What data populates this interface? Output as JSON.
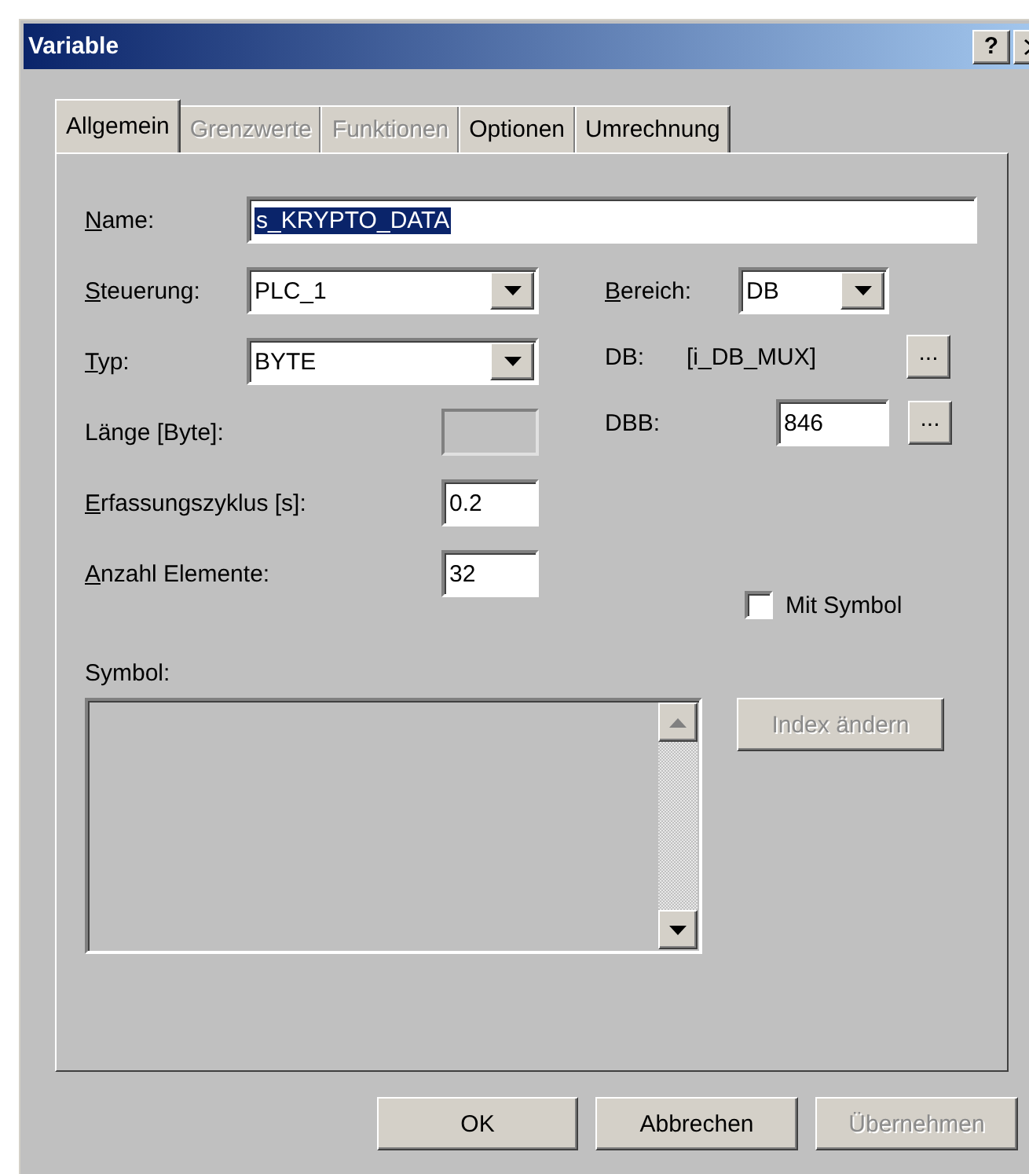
{
  "window": {
    "title": "Variable",
    "help_button": "?"
  },
  "tabs": [
    {
      "label": "Allgemein",
      "selected": true,
      "disabled": false
    },
    {
      "label": "Grenzwerte",
      "selected": false,
      "disabled": true
    },
    {
      "label": "Funktionen",
      "selected": false,
      "disabled": true
    },
    {
      "label": "Optionen",
      "selected": false,
      "disabled": false
    },
    {
      "label": "Umrechnung",
      "selected": false,
      "disabled": false
    }
  ],
  "form": {
    "name": {
      "label": "Name:",
      "mnemonic": true,
      "value": "s_KRYPTO_DATA",
      "highlighted": true
    },
    "left_rows": [
      {
        "kind": "select",
        "label": "Steuerung:",
        "mnemonic": true,
        "value": "PLC_1"
      },
      {
        "kind": "select",
        "label": "Typ:",
        "mnemonic": true,
        "value": "BYTE"
      },
      {
        "kind": "input",
        "label": "Länge [Byte]:",
        "mnemonic": false,
        "disabled": true
      },
      {
        "kind": "input",
        "label": "Erfassungszyklus [s]:",
        "mnemonic": true,
        "value": "0.2",
        "disabled": false
      },
      {
        "kind": "input",
        "label": "Anzahl Elemente:",
        "mnemonic": true,
        "value": "32",
        "disabled": false
      }
    ],
    "right_rows": [
      {
        "kind": "select",
        "label": "Bereich:",
        "mnemonic": true,
        "value": "DB"
      },
      {
        "kind": "text",
        "label": "DB:",
        "mnemonic": false,
        "value": "[i_DB_MUX]",
        "browse": "..."
      },
      {
        "kind": "input",
        "label": "DBB:",
        "mnemonic": false,
        "value": "846",
        "browse": "..."
      }
    ],
    "mit_symbol": {
      "label": "Mit Symbol",
      "checked": false
    },
    "symbol": {
      "label": "Symbol:"
    },
    "index_button": {
      "label": "Index ändern",
      "disabled": true
    }
  },
  "buttons": [
    {
      "label": "OK",
      "disabled": false
    },
    {
      "label": "Abbrechen",
      "disabled": false
    },
    {
      "label": "Übernehmen",
      "disabled": true
    }
  ]
}
